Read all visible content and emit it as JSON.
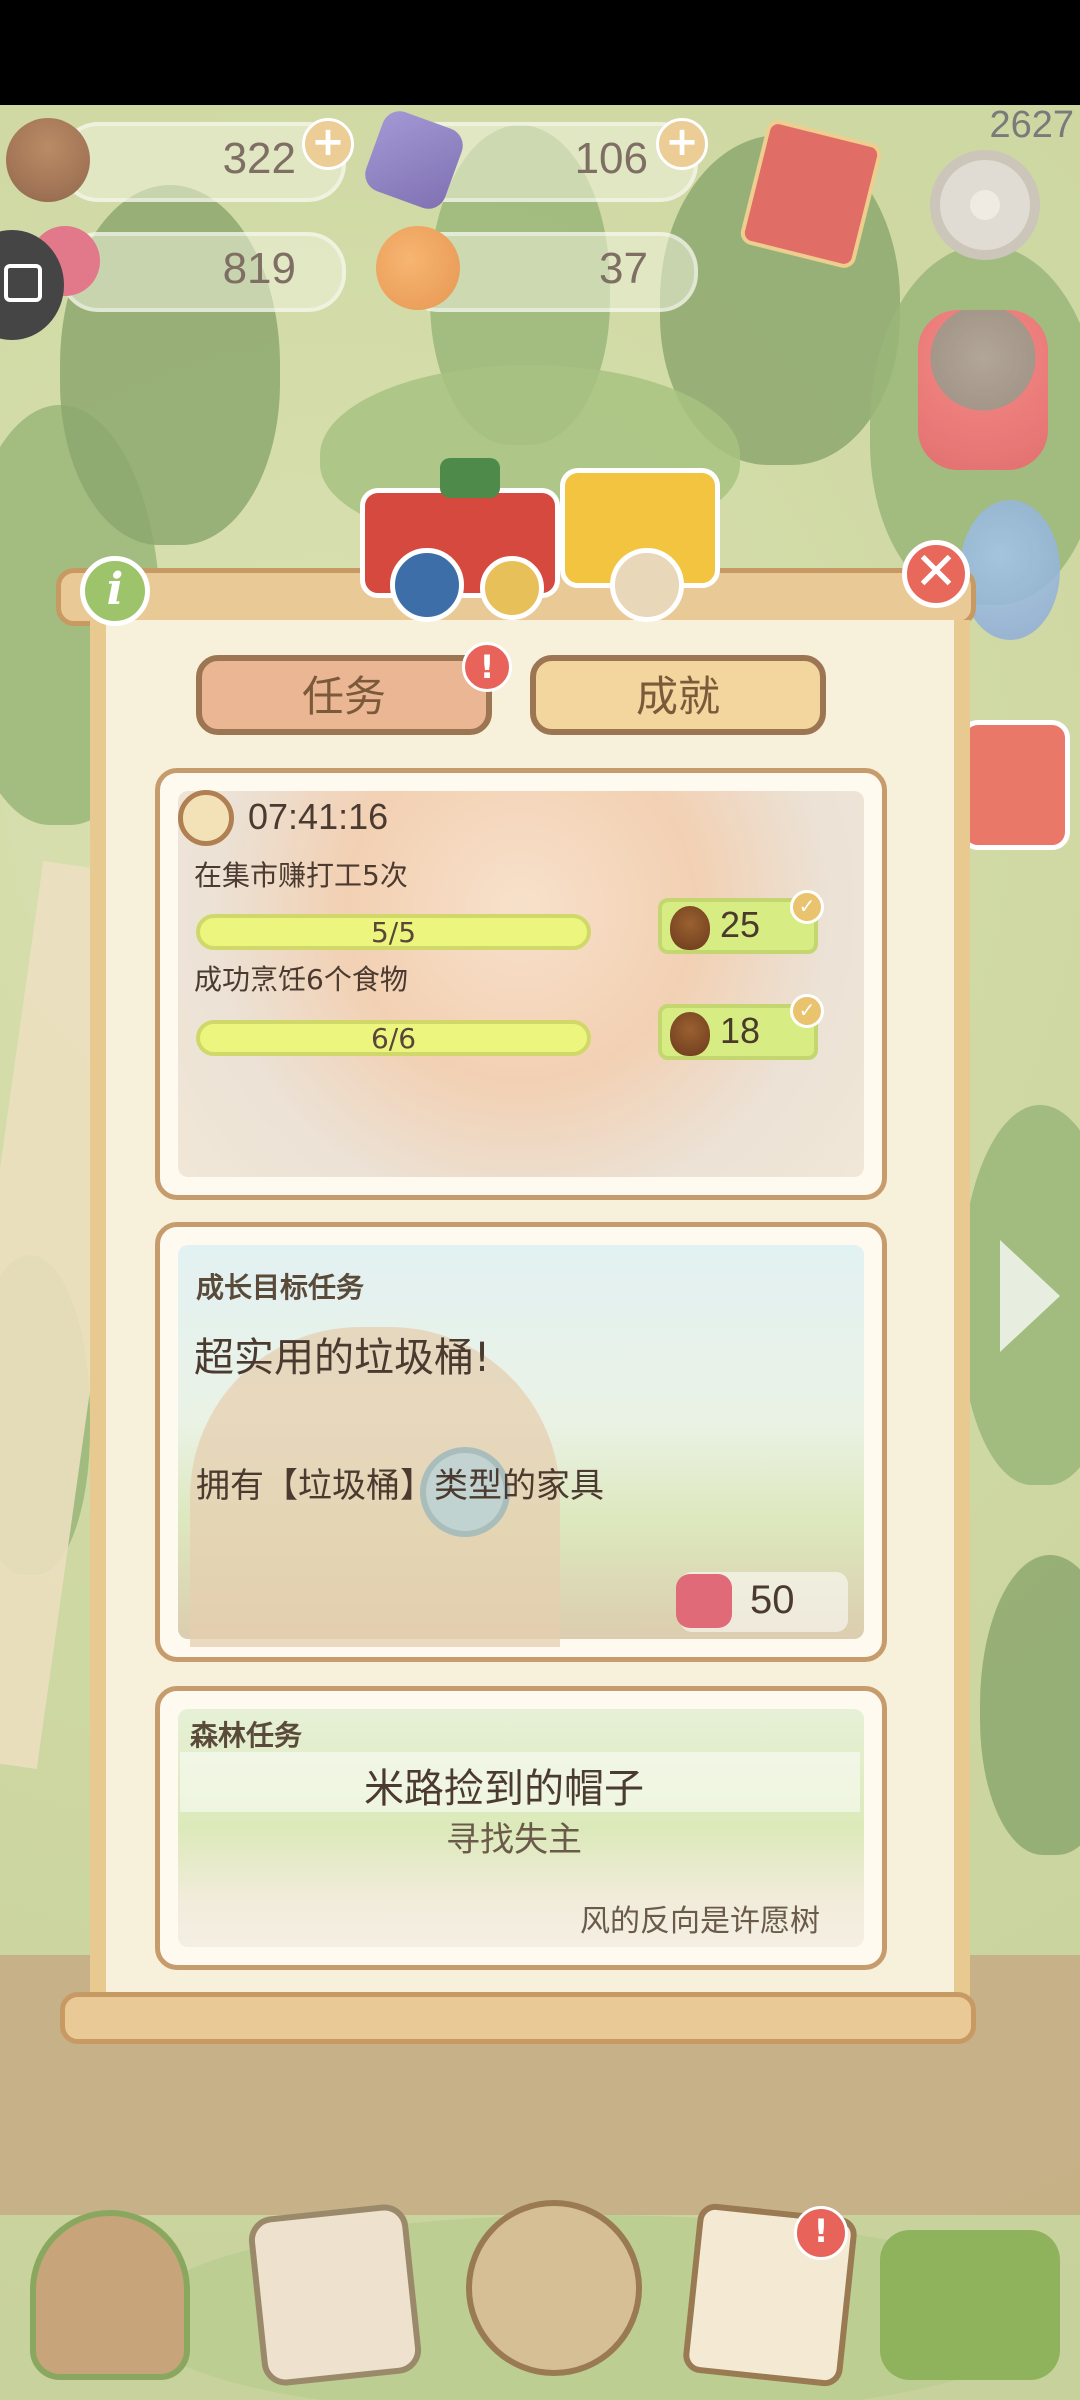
{
  "top_bar": {
    "score": "2627",
    "currencies": {
      "acorn": "322",
      "gem": "106",
      "heart": "819",
      "orange": "37"
    }
  },
  "tabs": {
    "tasks": "任务",
    "achievements": "成就",
    "tasks_badge": "!"
  },
  "daily": {
    "timer": "07:41:16",
    "tasks": [
      {
        "title": "在集市赚打工5次",
        "progress": "5/5",
        "reward": "25"
      },
      {
        "title": "成功烹饪6个食物",
        "progress": "6/6",
        "reward": "18"
      }
    ]
  },
  "growth": {
    "header": "成长目标任务",
    "title": "超实用的垃圾桶!",
    "desc": "拥有【垃圾桶】类型的家具",
    "reward": "50"
  },
  "forest": {
    "header": "森林任务",
    "title": "米路捡到的帽子",
    "subtitle": "寻找失主",
    "hint": "风的反向是许愿树"
  },
  "buttons": {
    "close": "✕",
    "info": "i"
  },
  "colors": {
    "accent_tab": "#ebb693",
    "progress": "#ecf57e",
    "reward": "#d8ec84",
    "close": "#e8695c"
  }
}
